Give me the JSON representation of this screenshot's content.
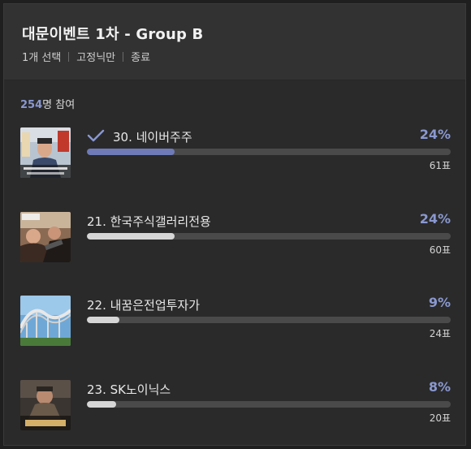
{
  "header": {
    "title": "대문이벤트 1차 - Group B",
    "meta": [
      "1개 선택",
      "고정닉만",
      "종료"
    ]
  },
  "participants": {
    "count": "254",
    "suffix": "명 참여"
  },
  "colors": {
    "accent": "#8a98d0",
    "selected_fill": "#6e7bb8",
    "fill": "#d6d6d6",
    "track": "#4a4a4a"
  },
  "options": [
    {
      "label": "30. 네이버주주",
      "percent": "24%",
      "votes": "61표",
      "fill": 0.24,
      "selected": true
    },
    {
      "label": "21. 한국주식갤러리전용",
      "percent": "24%",
      "votes": "60표",
      "fill": 0.24,
      "selected": false
    },
    {
      "label": "22. 내꿈은전업투자가",
      "percent": "9%",
      "votes": "24표",
      "fill": 0.09,
      "selected": false
    },
    {
      "label": "23. SK노이닉스",
      "percent": "8%",
      "votes": "20표",
      "fill": 0.08,
      "selected": false
    }
  ]
}
